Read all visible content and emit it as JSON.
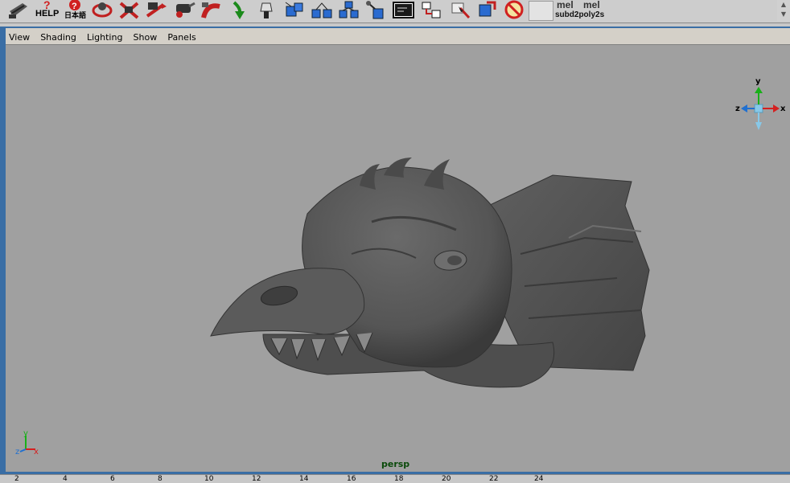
{
  "shelf": {
    "help_label": "HELP",
    "japanese_label": "日本語",
    "mel_buttons": [
      "mel",
      "mel"
    ],
    "mel_subtitle": "subd2poly2s",
    "icons": [
      "brush-icon",
      "help-icon",
      "help-jp-icon",
      "orbit-icon",
      "crossed-tools-icon",
      "move-tool-icon",
      "camera-tool-icon",
      "bend-icon",
      "down-arrow-icon",
      "lamp-icon",
      "cube-group-icon",
      "cube-hierarchy-icon",
      "cube-network-icon",
      "cube-link-icon",
      "script-editor-icon",
      "outliner-icon",
      "select-cube-icon",
      "cube-arrow-icon",
      "no-symbol-icon"
    ]
  },
  "panel": {
    "menu": [
      "View",
      "Shading",
      "Lighting",
      "Show",
      "Panels"
    ],
    "camera": "persp",
    "view_axes": {
      "x": "x",
      "y": "y",
      "z": "z"
    },
    "corner_axes": {
      "x": "x",
      "y": "y",
      "z": "z"
    }
  },
  "timeline": {
    "ticks": [
      "2",
      "4",
      "6",
      "8",
      "10",
      "12",
      "14",
      "16",
      "18",
      "20",
      "22",
      "24"
    ]
  },
  "colors": {
    "viewport_bg": "#a0a0a0",
    "model": "#565656",
    "panel_border": "#3a6ea5",
    "axis_x": "#d42020",
    "axis_y": "#18b018",
    "axis_z": "#2070d0"
  }
}
